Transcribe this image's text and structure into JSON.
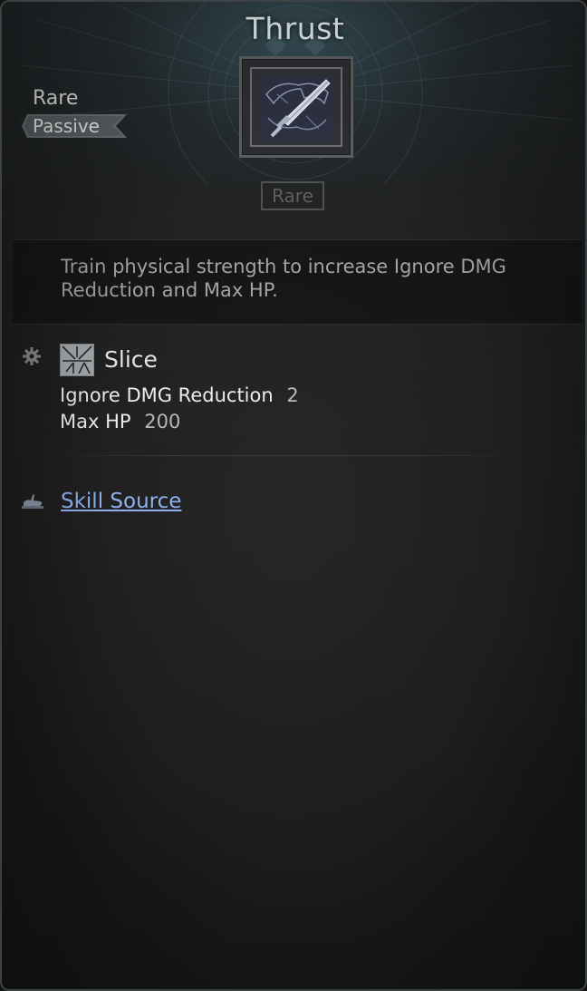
{
  "skill": {
    "title": "Thrust",
    "grade": "Rare",
    "type": "Passive",
    "badge": "Rare",
    "icon": "sword-icon",
    "description": "Train physical strength to increase Ignore DMG Reduction and Max HP."
  },
  "effect": {
    "section_icon": "gear-icon",
    "skill_icon": "slice-skill-icon",
    "name": "Slice",
    "stats": [
      {
        "label": "Ignore DMG Reduction",
        "value": "2"
      },
      {
        "label": "Max HP",
        "value": "200"
      }
    ]
  },
  "source": {
    "icon": "hand-pointer-icon",
    "link_label": "Skill Source"
  },
  "colors": {
    "title": "#dfe7ea",
    "link": "#8fb0ee",
    "description": "#a4a4a4",
    "badge_inactive": "#5f5f5f"
  }
}
